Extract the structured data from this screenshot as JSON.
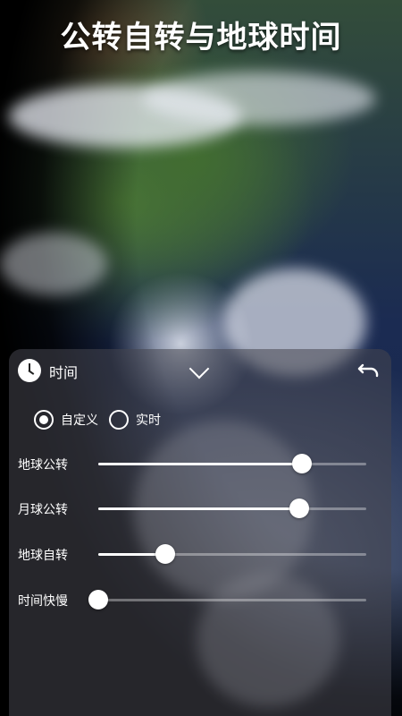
{
  "title": "公转自转与地球时间",
  "panel": {
    "header": {
      "icon": "clock-icon",
      "label": "时间",
      "collapse_icon": "chevron-down-icon",
      "reset_icon": "undo-icon"
    },
    "time_mode": {
      "options": [
        {
          "label": "自定义",
          "selected": true
        },
        {
          "label": "实时",
          "selected": false
        }
      ]
    },
    "sliders": [
      {
        "label": "地球公转",
        "value": 0.76
      },
      {
        "label": "月球公转",
        "value": 0.75
      },
      {
        "label": "地球自转",
        "value": 0.25
      },
      {
        "label": "时间快慢",
        "value": 0.0
      }
    ]
  }
}
